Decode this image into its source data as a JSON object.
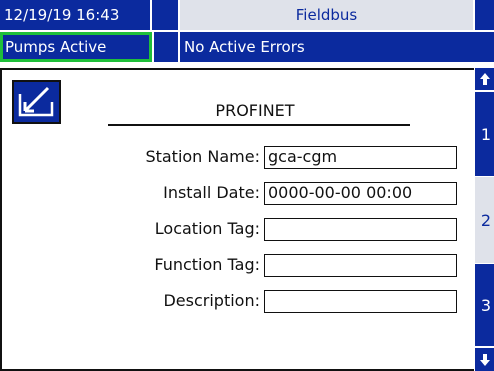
{
  "header": {
    "datetime": "12/19/19 16:43",
    "screen_title": "Fieldbus",
    "pump_status": "Pumps Active",
    "error_status": "No Active Errors"
  },
  "form": {
    "title": "PROFINET",
    "fields": [
      {
        "label": "Station Name:",
        "value": "gca-cgm"
      },
      {
        "label": "Install Date:",
        "value": "0000-00-00 00:00"
      },
      {
        "label": "Location Tag:",
        "value": ""
      },
      {
        "label": "Function Tag:",
        "value": ""
      },
      {
        "label": "Description:",
        "value": ""
      }
    ]
  },
  "nav": {
    "tabs": [
      "1",
      "2",
      "3"
    ],
    "up_icon": "arrow-up-icon",
    "down_icon": "arrow-down-icon",
    "edit_icon": "edit-icon"
  },
  "colors": {
    "accent": "#0b2a9e",
    "status_border": "#1fbf3a"
  }
}
